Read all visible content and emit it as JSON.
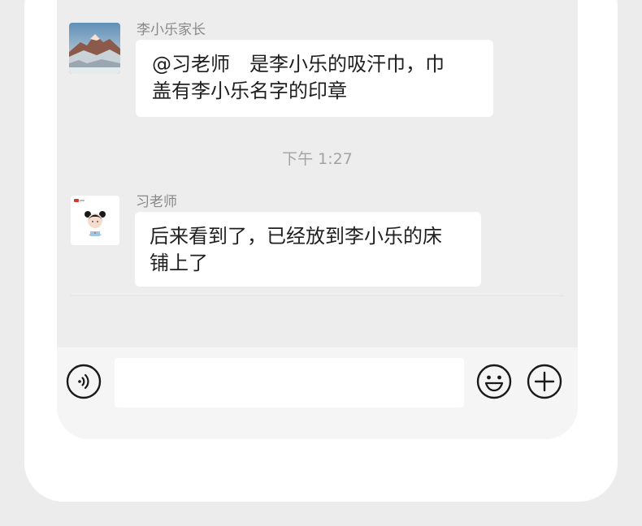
{
  "chat": {
    "messages": [
      {
        "sender": "李小乐家长",
        "lines": [
          "@习老师　是李小乐的吸汗巾，巾",
          "盖有李小乐名字的印章"
        ]
      },
      {
        "sender": "习老师",
        "lines": [
          "后来看到了，已经放到李小乐的床",
          "铺上了"
        ]
      }
    ],
    "timestamp": "下午 1:27"
  },
  "input_bar": {
    "placeholder": "",
    "voice_icon": "voice-icon",
    "emoji_icon": "emoji-icon",
    "add_icon": "plus-icon"
  },
  "colors": {
    "chat_background": "#ededed",
    "bubble": "#ffffff",
    "input_bar": "#f5f5f5"
  }
}
